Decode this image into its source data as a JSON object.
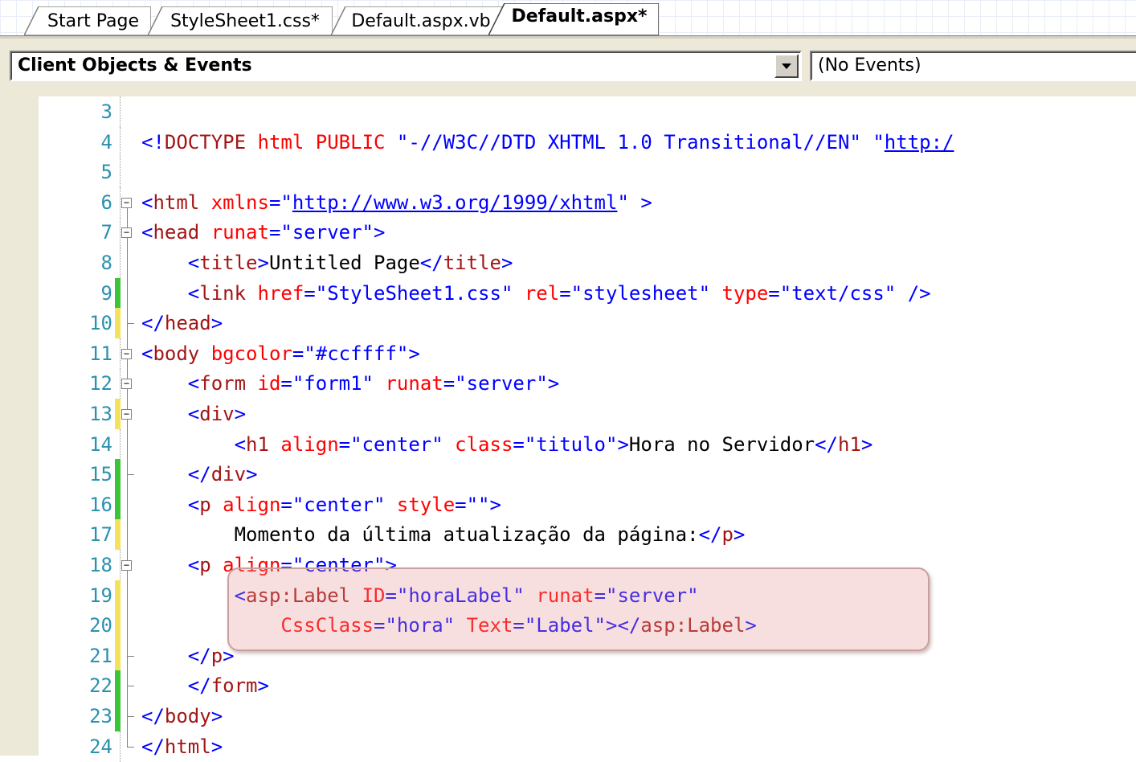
{
  "tabs": [
    {
      "label": "Start Page"
    },
    {
      "label": "StyleSheet1.css*"
    },
    {
      "label": "Default.aspx.vb"
    },
    {
      "label": "Default.aspx*"
    }
  ],
  "toolbar": {
    "objects_dropdown": "Client Objects & Events",
    "events_dropdown": "(No Events)"
  },
  "editor": {
    "lines": [
      {
        "n": "3",
        "tokens": []
      },
      {
        "n": "4",
        "tokens": [
          {
            "c": "t",
            "s": "<!"
          },
          {
            "c": "e",
            "s": "DOCTYPE"
          },
          {
            "c": "x",
            "s": " "
          },
          {
            "c": "a",
            "s": "html"
          },
          {
            "c": "x",
            "s": " "
          },
          {
            "c": "a",
            "s": "PUBLIC"
          },
          {
            "c": "x",
            "s": " "
          },
          {
            "c": "v",
            "s": "\"-//W3C//DTD XHTML 1.0 Transitional//EN\""
          },
          {
            "c": "x",
            "s": " "
          },
          {
            "c": "v",
            "s": "\""
          },
          {
            "c": "u",
            "s": "http:/"
          }
        ]
      },
      {
        "n": "5",
        "tokens": []
      },
      {
        "n": "6",
        "tokens": [
          {
            "c": "t",
            "s": "<"
          },
          {
            "c": "e",
            "s": "html"
          },
          {
            "c": "x",
            "s": " "
          },
          {
            "c": "a",
            "s": "xmlns"
          },
          {
            "c": "t",
            "s": "="
          },
          {
            "c": "v",
            "s": "\""
          },
          {
            "c": "u",
            "s": "http://www.w3.org/1999/xhtml"
          },
          {
            "c": "v",
            "s": "\""
          },
          {
            "c": "x",
            "s": " "
          },
          {
            "c": "t",
            "s": ">"
          }
        ]
      },
      {
        "n": "7",
        "tokens": [
          {
            "c": "t",
            "s": "<"
          },
          {
            "c": "e",
            "s": "head"
          },
          {
            "c": "x",
            "s": " "
          },
          {
            "c": "a",
            "s": "runat"
          },
          {
            "c": "t",
            "s": "="
          },
          {
            "c": "v",
            "s": "\"server\""
          },
          {
            "c": "t",
            "s": ">"
          }
        ]
      },
      {
        "n": "8",
        "tokens": [
          {
            "c": "x",
            "s": "    "
          },
          {
            "c": "t",
            "s": "<"
          },
          {
            "c": "e",
            "s": "title"
          },
          {
            "c": "t",
            "s": ">"
          },
          {
            "c": "x",
            "s": "Untitled Page"
          },
          {
            "c": "t",
            "s": "</"
          },
          {
            "c": "e",
            "s": "title"
          },
          {
            "c": "t",
            "s": ">"
          }
        ]
      },
      {
        "n": "9",
        "tokens": [
          {
            "c": "x",
            "s": "    "
          },
          {
            "c": "t",
            "s": "<"
          },
          {
            "c": "e",
            "s": "link"
          },
          {
            "c": "x",
            "s": " "
          },
          {
            "c": "a",
            "s": "href"
          },
          {
            "c": "t",
            "s": "="
          },
          {
            "c": "v",
            "s": "\"StyleSheet1.css\""
          },
          {
            "c": "x",
            "s": " "
          },
          {
            "c": "a",
            "s": "rel"
          },
          {
            "c": "t",
            "s": "="
          },
          {
            "c": "v",
            "s": "\"stylesheet\""
          },
          {
            "c": "x",
            "s": " "
          },
          {
            "c": "a",
            "s": "type"
          },
          {
            "c": "t",
            "s": "="
          },
          {
            "c": "v",
            "s": "\"text/css\""
          },
          {
            "c": "x",
            "s": " "
          },
          {
            "c": "t",
            "s": "/>"
          }
        ]
      },
      {
        "n": "10",
        "tokens": [
          {
            "c": "t",
            "s": "</"
          },
          {
            "c": "e",
            "s": "head"
          },
          {
            "c": "t",
            "s": ">"
          }
        ]
      },
      {
        "n": "11",
        "tokens": [
          {
            "c": "t",
            "s": "<"
          },
          {
            "c": "e",
            "s": "body"
          },
          {
            "c": "x",
            "s": " "
          },
          {
            "c": "a",
            "s": "bgcolor"
          },
          {
            "c": "t",
            "s": "="
          },
          {
            "c": "v",
            "s": "\"#ccffff\""
          },
          {
            "c": "t",
            "s": ">"
          }
        ]
      },
      {
        "n": "12",
        "tokens": [
          {
            "c": "x",
            "s": "    "
          },
          {
            "c": "t",
            "s": "<"
          },
          {
            "c": "e",
            "s": "form"
          },
          {
            "c": "x",
            "s": " "
          },
          {
            "c": "a",
            "s": "id"
          },
          {
            "c": "t",
            "s": "="
          },
          {
            "c": "v",
            "s": "\"form1\""
          },
          {
            "c": "x",
            "s": " "
          },
          {
            "c": "a",
            "s": "runat"
          },
          {
            "c": "t",
            "s": "="
          },
          {
            "c": "v",
            "s": "\"server\""
          },
          {
            "c": "t",
            "s": ">"
          }
        ]
      },
      {
        "n": "13",
        "tokens": [
          {
            "c": "x",
            "s": "    "
          },
          {
            "c": "t",
            "s": "<"
          },
          {
            "c": "e",
            "s": "div"
          },
          {
            "c": "t",
            "s": ">"
          }
        ]
      },
      {
        "n": "14",
        "tokens": [
          {
            "c": "x",
            "s": "        "
          },
          {
            "c": "t",
            "s": "<"
          },
          {
            "c": "e",
            "s": "h1"
          },
          {
            "c": "x",
            "s": " "
          },
          {
            "c": "a",
            "s": "align"
          },
          {
            "c": "t",
            "s": "="
          },
          {
            "c": "v",
            "s": "\"center\""
          },
          {
            "c": "x",
            "s": " "
          },
          {
            "c": "a",
            "s": "class"
          },
          {
            "c": "t",
            "s": "="
          },
          {
            "c": "v",
            "s": "\"titulo\""
          },
          {
            "c": "t",
            "s": ">"
          },
          {
            "c": "x",
            "s": "Hora no Servidor"
          },
          {
            "c": "t",
            "s": "</"
          },
          {
            "c": "e",
            "s": "h1"
          },
          {
            "c": "t",
            "s": ">"
          }
        ]
      },
      {
        "n": "15",
        "tokens": [
          {
            "c": "x",
            "s": "    "
          },
          {
            "c": "t",
            "s": "</"
          },
          {
            "c": "e",
            "s": "div"
          },
          {
            "c": "t",
            "s": ">"
          }
        ]
      },
      {
        "n": "16",
        "tokens": [
          {
            "c": "x",
            "s": "    "
          },
          {
            "c": "t",
            "s": "<"
          },
          {
            "c": "e",
            "s": "p"
          },
          {
            "c": "x",
            "s": " "
          },
          {
            "c": "a",
            "s": "align"
          },
          {
            "c": "t",
            "s": "="
          },
          {
            "c": "v",
            "s": "\"center\""
          },
          {
            "c": "x",
            "s": " "
          },
          {
            "c": "a",
            "s": "style"
          },
          {
            "c": "t",
            "s": "="
          },
          {
            "c": "v",
            "s": "\"\""
          },
          {
            "c": "t",
            "s": ">"
          }
        ]
      },
      {
        "n": "17",
        "tokens": [
          {
            "c": "x",
            "s": "        Momento da última atualização da página:"
          },
          {
            "c": "t",
            "s": "</"
          },
          {
            "c": "e",
            "s": "p"
          },
          {
            "c": "t",
            "s": ">"
          }
        ]
      },
      {
        "n": "18",
        "tokens": [
          {
            "c": "x",
            "s": "    "
          },
          {
            "c": "t",
            "s": "<"
          },
          {
            "c": "e",
            "s": "p"
          },
          {
            "c": "x",
            "s": " "
          },
          {
            "c": "a",
            "s": "align"
          },
          {
            "c": "t",
            "s": "="
          },
          {
            "c": "v",
            "s": "\"center\""
          },
          {
            "c": "t",
            "s": ">"
          }
        ]
      },
      {
        "n": "19",
        "tokens": [
          {
            "c": "x",
            "s": "        "
          },
          {
            "c": "t",
            "s": "<"
          },
          {
            "c": "e",
            "s": "asp:Label"
          },
          {
            "c": "x",
            "s": " "
          },
          {
            "c": "a",
            "s": "ID"
          },
          {
            "c": "t",
            "s": "="
          },
          {
            "c": "v",
            "s": "\"horaLabel\""
          },
          {
            "c": "x",
            "s": " "
          },
          {
            "c": "a",
            "s": "runat"
          },
          {
            "c": "t",
            "s": "="
          },
          {
            "c": "v",
            "s": "\"server\""
          }
        ]
      },
      {
        "n": "20",
        "tokens": [
          {
            "c": "x",
            "s": "            "
          },
          {
            "c": "a",
            "s": "CssClass"
          },
          {
            "c": "t",
            "s": "="
          },
          {
            "c": "v",
            "s": "\"hora\""
          },
          {
            "c": "x",
            "s": " "
          },
          {
            "c": "a",
            "s": "Text"
          },
          {
            "c": "t",
            "s": "="
          },
          {
            "c": "v",
            "s": "\"Label\""
          },
          {
            "c": "t",
            "s": "></"
          },
          {
            "c": "e",
            "s": "asp:Label"
          },
          {
            "c": "t",
            "s": ">"
          }
        ]
      },
      {
        "n": "21",
        "tokens": [
          {
            "c": "x",
            "s": "    "
          },
          {
            "c": "t",
            "s": "</"
          },
          {
            "c": "e",
            "s": "p"
          },
          {
            "c": "t",
            "s": ">"
          }
        ]
      },
      {
        "n": "22",
        "tokens": [
          {
            "c": "x",
            "s": "    "
          },
          {
            "c": "t",
            "s": "</"
          },
          {
            "c": "e",
            "s": "form"
          },
          {
            "c": "t",
            "s": ">"
          }
        ]
      },
      {
        "n": "23",
        "tokens": [
          {
            "c": "t",
            "s": "</"
          },
          {
            "c": "e",
            "s": "body"
          },
          {
            "c": "t",
            "s": ">"
          }
        ]
      },
      {
        "n": "24",
        "tokens": [
          {
            "c": "t",
            "s": "</"
          },
          {
            "c": "e",
            "s": "html"
          },
          {
            "c": "t",
            "s": ">"
          }
        ]
      }
    ]
  },
  "colors": {
    "tag": "#0000ff",
    "element": "#a31515",
    "attribute": "#ff0000",
    "value": "#0000ff",
    "text": "#000000",
    "line_number": "#2b91af",
    "changed_saved": "#39c439",
    "changed_unsaved": "#f4e35a",
    "callout": "#e89696"
  }
}
